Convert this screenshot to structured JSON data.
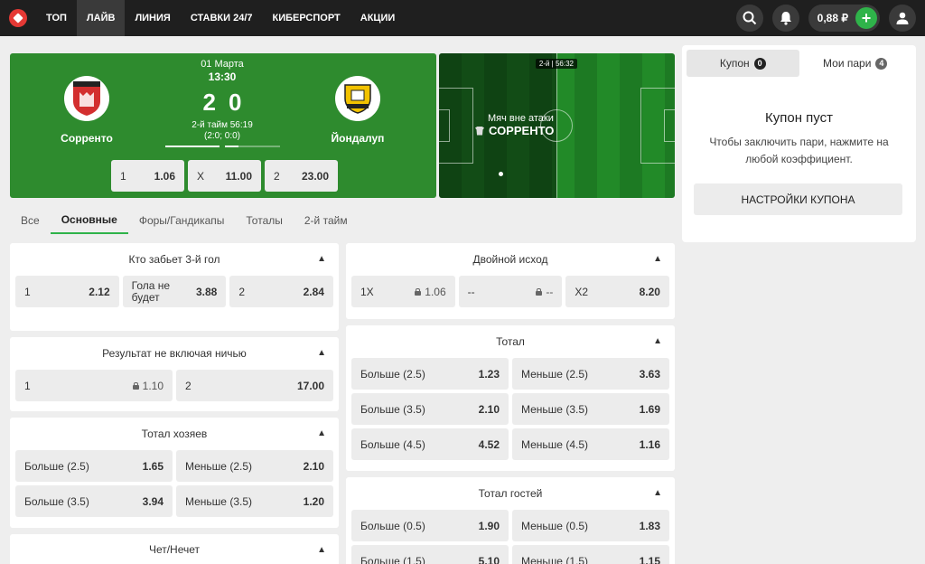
{
  "nav": {
    "items": [
      {
        "label": "ТОП"
      },
      {
        "label": "ЛАЙВ"
      },
      {
        "label": "ЛИНИЯ"
      },
      {
        "label": "СТАВКИ 24/7"
      },
      {
        "label": "КИБЕРСПОРТ"
      },
      {
        "label": "АКЦИИ"
      }
    ],
    "active": "ЛАЙВ",
    "balance": "0,88 ₽",
    "plus": "+"
  },
  "match": {
    "date": "01 Марта",
    "time": "13:30",
    "home": {
      "name": "Сорренто",
      "score": "2"
    },
    "away": {
      "name": "Йондалуп",
      "score": "0"
    },
    "period": "2-й тайм 56:19",
    "period_scores": "(2:0; 0:0)",
    "progress_first_half": 1.0,
    "progress_second_half": 0.25,
    "odds": [
      {
        "label": "1",
        "value": "1.06"
      },
      {
        "label": "X",
        "value": "11.00"
      },
      {
        "label": "2",
        "value": "23.00"
      }
    ]
  },
  "field": {
    "timer": "2-й | 56:32",
    "event_title": "Мяч вне атаки",
    "event_team": "СОРРЕНТО"
  },
  "tabs": [
    {
      "label": "Все"
    },
    {
      "label": "Основные"
    },
    {
      "label": "Форы/Гандикапы"
    },
    {
      "label": "Тоталы"
    },
    {
      "label": "2-й тайм"
    }
  ],
  "markets_left": {
    "third_goal": {
      "title": "Кто забьет 3-й гол",
      "cells": [
        {
          "label": "1",
          "value": "2.12"
        },
        {
          "label": "Гола не будет",
          "value": "3.88"
        },
        {
          "label": "2",
          "value": "2.84"
        }
      ]
    },
    "no_draw": {
      "title": "Результат не включая ничью",
      "cells": [
        {
          "label": "1",
          "value": "1.10",
          "locked": true
        },
        {
          "label": "2",
          "value": "17.00"
        }
      ]
    },
    "home_total": {
      "title": "Тотал хозяев",
      "cells": [
        {
          "label": "Больше (2.5)",
          "value": "1.65"
        },
        {
          "label": "Меньше (2.5)",
          "value": "2.10"
        },
        {
          "label": "Больше (3.5)",
          "value": "3.94"
        },
        {
          "label": "Меньше (3.5)",
          "value": "1.20"
        }
      ]
    },
    "odd_even": {
      "title": "Чет/Нечет"
    }
  },
  "markets_right": {
    "double_chance": {
      "title": "Двойной исход",
      "cells": [
        {
          "label": "1X",
          "value": "1.06",
          "locked": true
        },
        {
          "label": "--",
          "value": "--",
          "locked": true
        },
        {
          "label": "X2",
          "value": "8.20"
        }
      ]
    },
    "total": {
      "title": "Тотал",
      "cells": [
        {
          "label": "Больше (2.5)",
          "value": "1.23"
        },
        {
          "label": "Меньше (2.5)",
          "value": "3.63"
        },
        {
          "label": "Больше (3.5)",
          "value": "2.10"
        },
        {
          "label": "Меньше (3.5)",
          "value": "1.69"
        },
        {
          "label": "Больше (4.5)",
          "value": "4.52"
        },
        {
          "label": "Меньше (4.5)",
          "value": "1.16"
        }
      ]
    },
    "away_total": {
      "title": "Тотал гостей",
      "cells": [
        {
          "label": "Больше (0.5)",
          "value": "1.90"
        },
        {
          "label": "Меньше (0.5)",
          "value": "1.83"
        },
        {
          "label": "Больше (1.5)",
          "value": "5.10"
        },
        {
          "label": "Меньше (1.5)",
          "value": "1.15"
        }
      ]
    }
  },
  "coupon": {
    "tab_coupon": "Купон",
    "tab_coupon_count": "0",
    "tab_bets": "Мои пари",
    "tab_bets_count": "4",
    "empty_title": "Купон пуст",
    "empty_hint": "Чтобы заключить пари, нажмите на любой коэффициент.",
    "settings_button": "НАСТРОЙКИ КУПОНА"
  },
  "colors": {
    "accent": "#2fb34a",
    "match_bg": "#2e8b2e",
    "topbar": "#1f1f1f",
    "home_crest": "#d32f2f",
    "away_crest": "#f2c200"
  },
  "icons": [
    "logo-icon",
    "search-icon",
    "bell-icon",
    "user-icon",
    "chevron-up-icon",
    "lock-icon",
    "shirt-icon"
  ]
}
